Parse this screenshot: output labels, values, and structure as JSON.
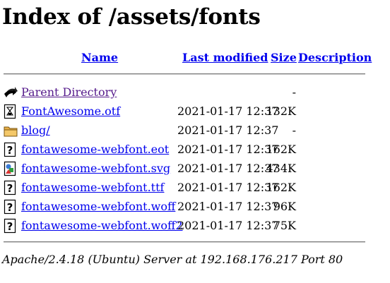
{
  "page_title": "Index of /assets/fonts",
  "columns": {
    "name": "Name",
    "last_modified": "Last modified",
    "size": "Size",
    "description": "Description"
  },
  "entries": [
    {
      "name": "Parent Directory",
      "modified": "",
      "size": "-",
      "icon": "back-icon"
    },
    {
      "name": "FontAwesome.otf",
      "modified": "2021-01-17 12:37",
      "size": "132K",
      "icon": "binary-file-icon"
    },
    {
      "name": "blog/",
      "modified": "2021-01-17 12:37",
      "size": "-",
      "icon": "folder-icon"
    },
    {
      "name": "fontawesome-webfont.eot",
      "modified": "2021-01-17 12:37",
      "size": "162K",
      "icon": "unknown-file-icon"
    },
    {
      "name": "fontawesome-webfont.svg",
      "modified": "2021-01-17 12:37",
      "size": "434K",
      "icon": "image-file-icon"
    },
    {
      "name": "fontawesome-webfont.ttf",
      "modified": "2021-01-17 12:37",
      "size": "162K",
      "icon": "unknown-file-icon"
    },
    {
      "name": "fontawesome-webfont.woff",
      "modified": "2021-01-17 12:37",
      "size": "96K",
      "icon": "unknown-file-icon"
    },
    {
      "name": "fontawesome-webfont.woff2",
      "modified": "2021-01-17 12:37",
      "size": "75K",
      "icon": "unknown-file-icon"
    }
  ],
  "server_signature": "Apache/2.4.18 (Ubuntu) Server at 192.168.176.217 Port 80",
  "colors": {
    "link": "#0000ee",
    "visited_link": "#551a8b"
  }
}
